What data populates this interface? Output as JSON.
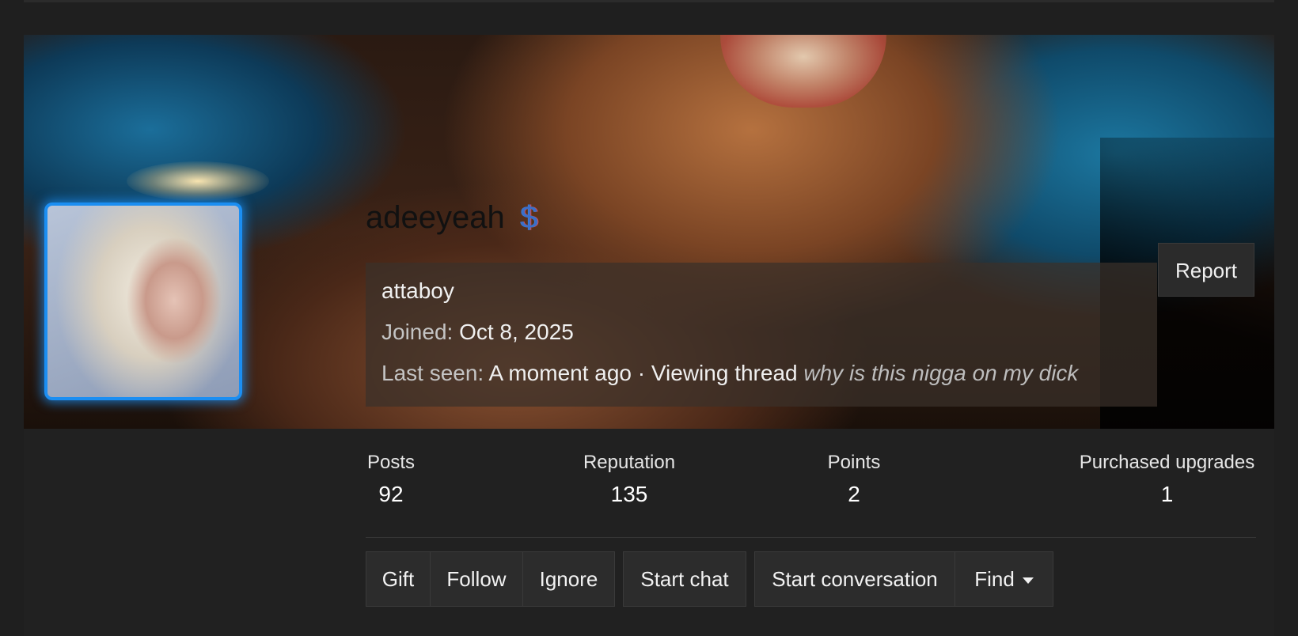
{
  "profile": {
    "username": "adeeyeah",
    "badge": "$",
    "custom_title": "attaboy",
    "joined_label": "Joined:",
    "joined_value": "Oct 8, 2025",
    "last_seen_label": "Last seen:",
    "last_seen_value": "A moment ago · Viewing thread",
    "last_seen_thread": "why is this nigga on my dick",
    "report_label": "Report",
    "avatar_border_color": "#1b8ef2"
  },
  "stats": [
    {
      "label": "Posts",
      "value": "92"
    },
    {
      "label": "Reputation",
      "value": "135"
    },
    {
      "label": "Points",
      "value": "2"
    },
    {
      "label": "Purchased upgrades",
      "value": "1"
    }
  ],
  "actions": {
    "gift": "Gift",
    "follow": "Follow",
    "ignore": "Ignore",
    "start_chat": "Start chat",
    "start_conversation": "Start conversation",
    "find": "Find"
  }
}
